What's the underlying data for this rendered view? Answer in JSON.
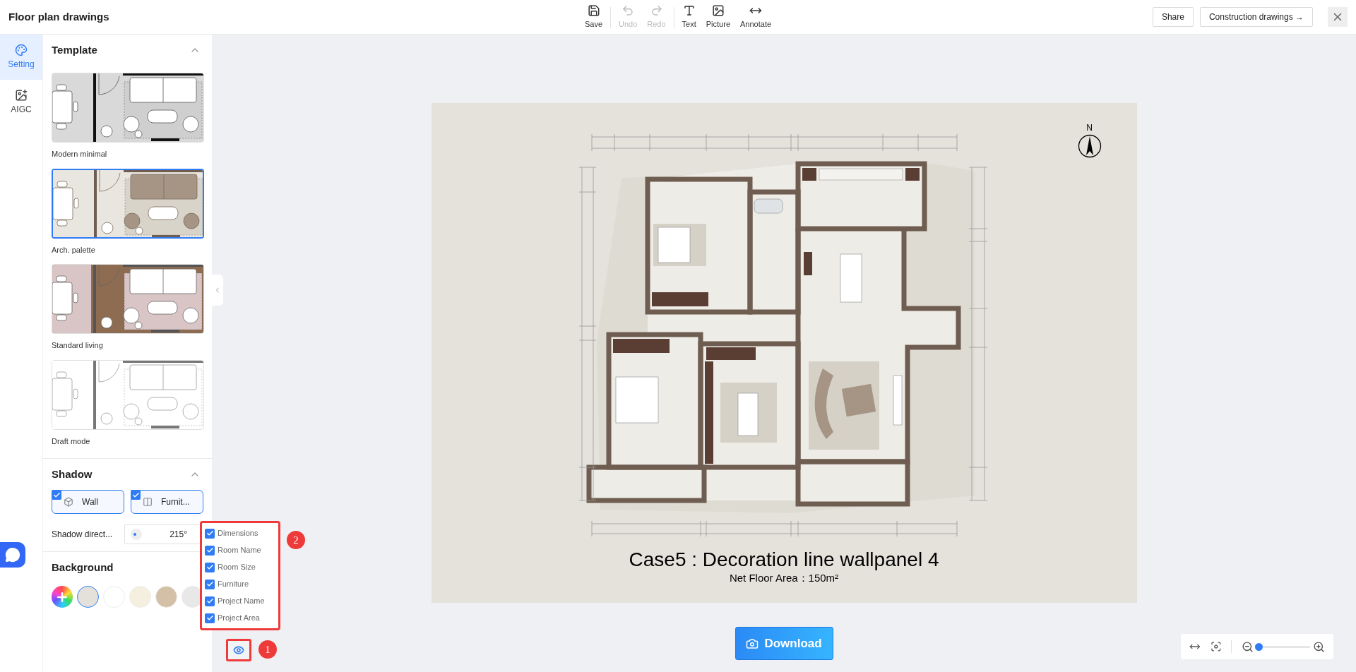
{
  "title": "Floor plan drawings",
  "toolbar": [
    {
      "label": "Save",
      "disabled": false
    },
    {
      "label": "Undo",
      "disabled": true
    },
    {
      "label": "Redo",
      "disabled": true
    },
    {
      "label": "Text",
      "disabled": false
    },
    {
      "label": "Picture",
      "disabled": false
    },
    {
      "label": "Annotate",
      "disabled": false
    }
  ],
  "share": "Share",
  "construction": "Construction drawings →",
  "rail": [
    {
      "label": "Setting",
      "selected": true
    },
    {
      "label": "AIGC",
      "selected": false
    }
  ],
  "template": {
    "title": "Template",
    "expanded": true,
    "items": [
      {
        "label": "Modern minimal",
        "selected": false
      },
      {
        "label": "Arch. palette",
        "selected": true
      },
      {
        "label": "Standard living",
        "selected": false
      },
      {
        "label": "Draft mode",
        "selected": false
      }
    ]
  },
  "shadow": {
    "title": "Shadow",
    "expanded": true,
    "options": [
      {
        "label": "Wall",
        "checked": true
      },
      {
        "label": "Furnit...",
        "checked": true
      }
    ],
    "direction_label": "Shadow direct...",
    "direction_value": "215°"
  },
  "background": {
    "title": "Background",
    "swatches": [
      {
        "kind": "custom",
        "selected": false
      },
      {
        "kind": "color",
        "color": "#e4e1da",
        "selected": true
      },
      {
        "kind": "color",
        "color": "#ffffff",
        "selected": false
      },
      {
        "kind": "color",
        "color": "#f5efdf",
        "selected": false
      },
      {
        "kind": "color",
        "color": "#d3c0a6",
        "selected": false
      },
      {
        "kind": "color",
        "color": "#e8e8e8",
        "selected": false
      }
    ]
  },
  "canvas": {
    "compass": "N",
    "project_name": "Case5 : Decoration line wallpanel 4",
    "project_area": "Net Floor Area：150m²"
  },
  "layers": [
    {
      "label": "Dimensions",
      "checked": true
    },
    {
      "label": "Room Name",
      "checked": true
    },
    {
      "label": "Room Size",
      "checked": true
    },
    {
      "label": "Furniture",
      "checked": true
    },
    {
      "label": "Project Name",
      "checked": true
    },
    {
      "label": "Project Area",
      "checked": true
    }
  ],
  "markers": [
    "1",
    "2"
  ],
  "download": "Download",
  "zoom": {
    "level": 0.0
  }
}
